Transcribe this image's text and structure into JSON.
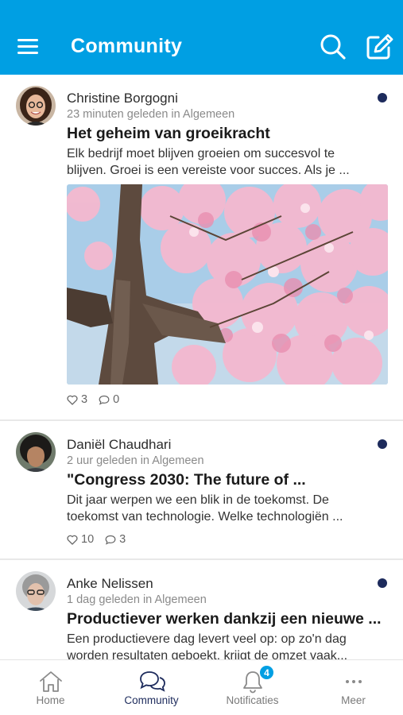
{
  "header": {
    "title": "Community"
  },
  "colors": {
    "primary": "#009fe3",
    "unread_dot": "#1d2b5c",
    "active_tab": "#1d2b5c"
  },
  "posts": [
    {
      "author": "Christine Borgogni",
      "meta": "23 minuten geleden in Algemeen",
      "title": "Het geheim van groeikracht",
      "excerpt_line1": "Elk bedrijf moet blijven groeien om succesvol te",
      "excerpt_line2": "blijven. Groei is een vereiste voor succes. Als je ...",
      "image": "cherry-blossom-tree-photo",
      "likes": "3",
      "comments": "0",
      "unread": true
    },
    {
      "author": "Daniël Chaudhari",
      "meta": "2 uur geleden in Algemeen",
      "title": "\"Congress 2030: The future of ...",
      "excerpt_line1": "Dit jaar werpen we een blik in de toekomst. De",
      "excerpt_line2": "toekomst van technologie. Welke technologiën ...",
      "likes": "10",
      "comments": "3",
      "unread": true
    },
    {
      "author": "Anke Nelissen",
      "meta": "1 dag geleden in Algemeen",
      "title": "Productiever werken dankzij een nieuwe ...",
      "excerpt_line1": "Een productievere dag levert veel op: op zo'n dag",
      "excerpt_line2": "worden resultaten geboekt, krijgt de omzet vaak...",
      "unread": true
    }
  ],
  "tabbar": {
    "items": [
      {
        "label": "Home",
        "icon": "home-icon"
      },
      {
        "label": "Community",
        "icon": "chat-bubbles-icon",
        "active": true
      },
      {
        "label": "Notificaties",
        "icon": "bell-icon",
        "badge": "4"
      },
      {
        "label": "Meer",
        "icon": "more-dots-icon"
      }
    ]
  }
}
